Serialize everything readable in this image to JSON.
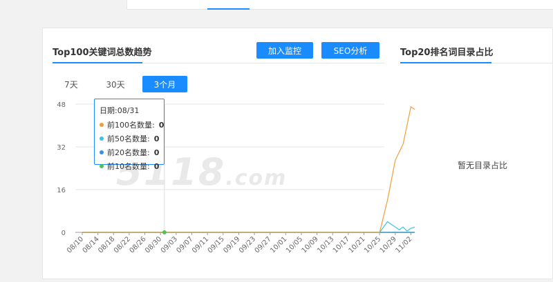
{
  "main_card": {
    "trend_title": "Top100关键词总数趋势",
    "buttons": {
      "monitor": "加入监控",
      "seo": "SEO分析"
    },
    "range_tabs": [
      {
        "label": "7天",
        "active": false
      },
      {
        "label": "30天",
        "active": false
      },
      {
        "label": "3个月",
        "active": true
      }
    ],
    "tooltip": {
      "date": "日期:08/31",
      "rows": [
        {
          "label": "前100名数量:",
          "value": "0",
          "color": "#f29c38"
        },
        {
          "label": "前50名数量:",
          "value": "0",
          "color": "#3ec1e4"
        },
        {
          "label": "前20名数量:",
          "value": "0",
          "color": "#3a8ee6"
        },
        {
          "label": "前10名数量:",
          "value": "0",
          "color": "#4fc24f"
        }
      ]
    }
  },
  "side_card": {
    "title": "Top20排名词目录占比",
    "empty_text": "暂无目录占比"
  },
  "watermark": "5118.com",
  "colors": {
    "accent": "#1a8cff"
  },
  "chart_data": {
    "type": "line",
    "x": [
      "08/10",
      "08/14",
      "08/18",
      "08/22",
      "08/26",
      "08/30",
      "09/03",
      "09/07",
      "09/11",
      "09/15",
      "09/19",
      "09/23",
      "09/27",
      "10/01",
      "10/05",
      "10/09",
      "10/13",
      "10/17",
      "10/21",
      "10/25",
      "10/29",
      "11/02"
    ],
    "y_ticks": [
      0,
      16,
      32,
      48
    ],
    "ylim": [
      0,
      48
    ],
    "series": [
      {
        "name": "前100名",
        "color": "#f29c38",
        "points": [
          [
            "08/10",
            0
          ],
          [
            "10/25",
            0
          ],
          [
            "10/27",
            12
          ],
          [
            "10/29",
            27
          ],
          [
            "10/31",
            33
          ],
          [
            "11/02",
            47
          ],
          [
            "11/03",
            46
          ]
        ]
      },
      {
        "name": "前50名",
        "color": "#3ec1e4",
        "points": [
          [
            "08/10",
            0
          ],
          [
            "10/25",
            0
          ],
          [
            "10/27",
            4
          ],
          [
            "10/29",
            2
          ],
          [
            "10/30",
            1
          ],
          [
            "10/31",
            2
          ],
          [
            "11/01",
            0.5
          ],
          [
            "11/02",
            1.5
          ],
          [
            "11/03",
            2
          ]
        ]
      },
      {
        "name": "前20名",
        "color": "#3a8ee6",
        "points": [
          [
            "08/10",
            0
          ],
          [
            "11/03",
            0
          ]
        ]
      },
      {
        "name": "前10名",
        "color": "#4fc24f",
        "points": [
          [
            "08/10",
            0
          ],
          [
            "11/03",
            0
          ]
        ]
      }
    ],
    "highlight_x": "08/31"
  }
}
